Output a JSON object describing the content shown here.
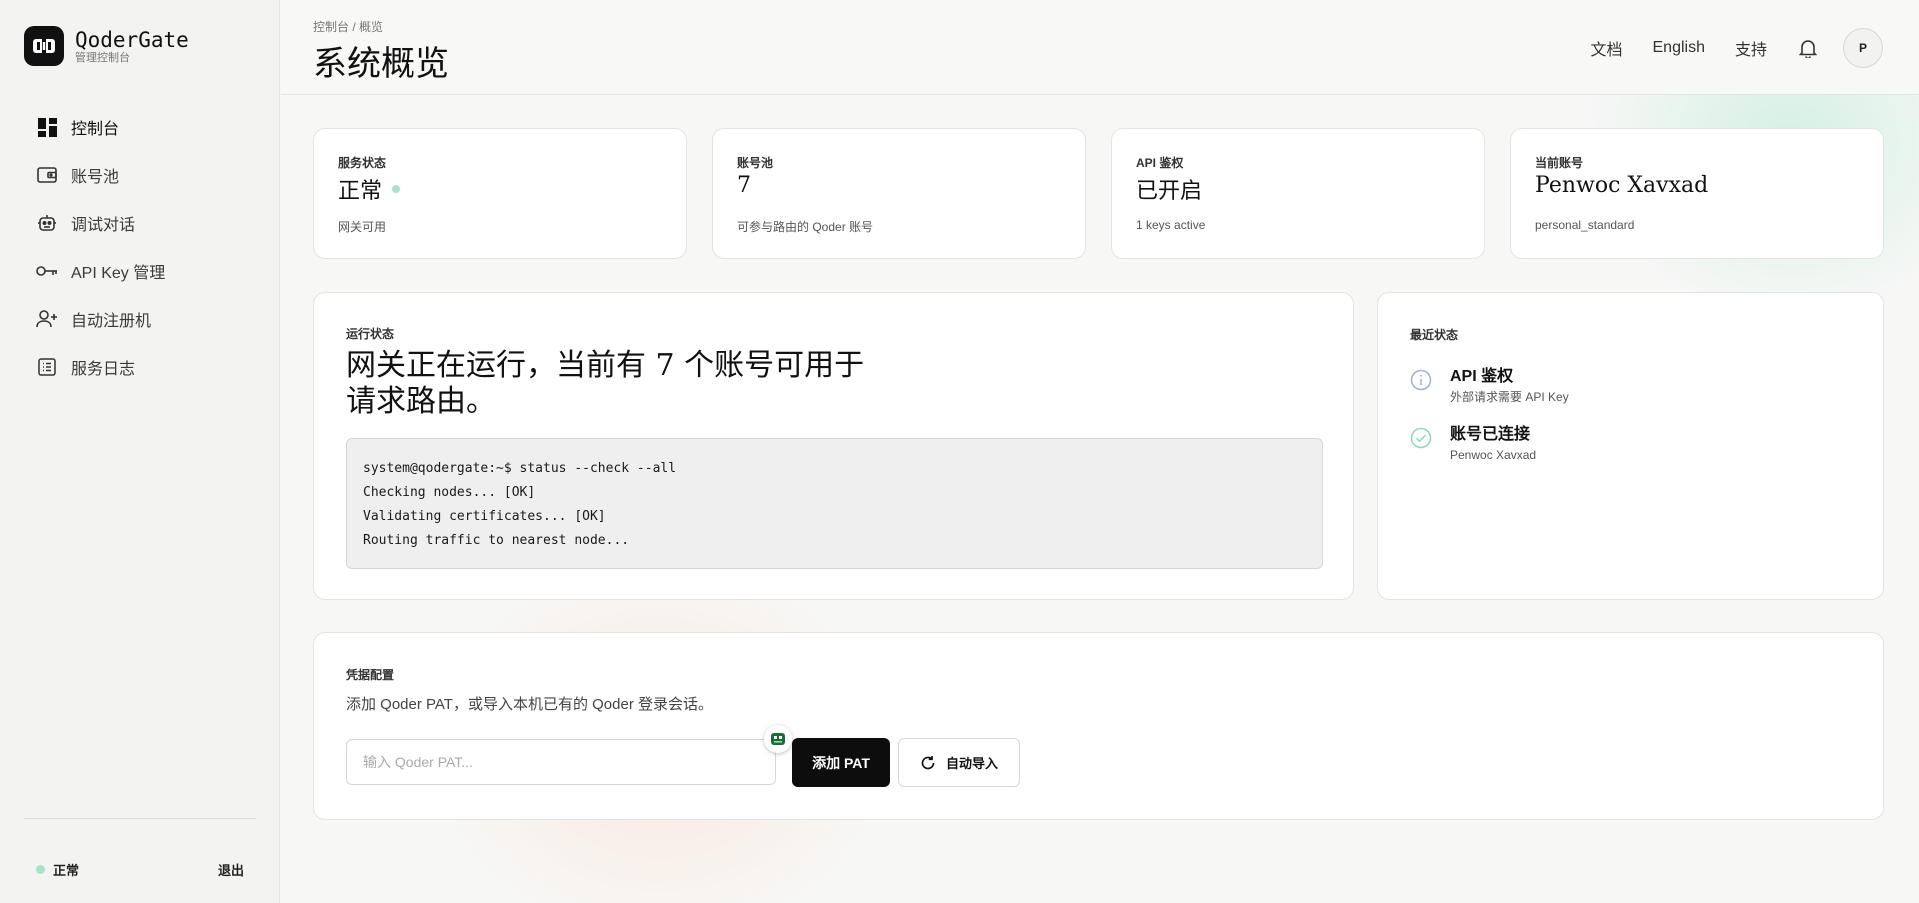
{
  "brand": {
    "name": "QoderGate",
    "subtitle": "管理控制台"
  },
  "sidebar": {
    "items": [
      {
        "label": "控制台",
        "icon": "dashboard-icon",
        "active": true
      },
      {
        "label": "账号池",
        "icon": "wallet-icon"
      },
      {
        "label": "调试对话",
        "icon": "robot-icon"
      },
      {
        "label": "API Key 管理",
        "icon": "key-icon"
      },
      {
        "label": "自动注册机",
        "icon": "user-plus-icon"
      },
      {
        "label": "服务日志",
        "icon": "list-icon"
      }
    ],
    "footer": {
      "status": "正常",
      "logout": "退出"
    }
  },
  "header": {
    "breadcrumb": "控制台 / 概览",
    "title": "系统概览",
    "links": [
      "文档",
      "English",
      "支持"
    ],
    "avatar": "P"
  },
  "stats": [
    {
      "label": "服务状态",
      "value": "正常",
      "sub": "网关可用",
      "dot": true
    },
    {
      "label": "账号池",
      "value": "7",
      "sub": "可参与路由的 Qoder 账号"
    },
    {
      "label": "API 鉴权",
      "value": "已开启",
      "sub": "1 keys active"
    },
    {
      "label": "当前账号",
      "value": "Penwoc Xavxad",
      "sub": "personal_standard"
    }
  ],
  "running": {
    "label": "运行状态",
    "headline": "网关正在运行，当前有 7 个账号可用于请求路由。",
    "terminal": [
      "system@qodergate:~$ status --check --all",
      "Checking nodes... [OK]",
      "Validating certificates... [OK]",
      "Routing traffic to nearest node..."
    ]
  },
  "recent": {
    "label": "最近状态",
    "items": [
      {
        "title": "API 鉴权",
        "sub": "外部请求需要 API Key",
        "icon": "info-icon"
      },
      {
        "title": "账号已连接",
        "sub": "Penwoc Xavxad",
        "icon": "check-circle-icon"
      }
    ]
  },
  "credentials": {
    "label": "凭据配置",
    "description": "添加 Qoder PAT，或导入本机已有的 Qoder 登录会话。",
    "input_placeholder": "输入 Qoder PAT...",
    "add_button": "添加 PAT",
    "import_button": "自动导入"
  },
  "colors": {
    "accent_green": "#a8e3c8",
    "primary_button": "#0d0d0d"
  }
}
